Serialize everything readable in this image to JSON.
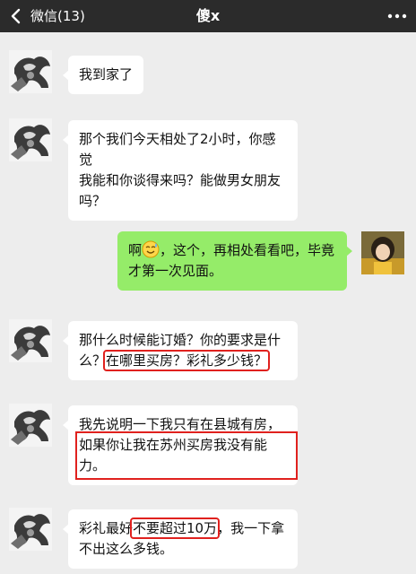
{
  "header": {
    "back_label": "微信(13)",
    "title": "傻x",
    "more_icon": "more-dots-icon"
  },
  "colors": {
    "header_bg": "#2b2b2b",
    "chat_bg": "#ededed",
    "incoming_bubble": "#ffffff",
    "outgoing_bubble": "#95ec69",
    "highlight_box": "#e0211e"
  },
  "messages": [
    {
      "side": "left",
      "text": "我到家了"
    },
    {
      "side": "left",
      "line1": "那个我们今天相处了2小时，你感觉",
      "line2": "我能和你谈得来吗？能做男女朋友",
      "line3": "吗？"
    },
    {
      "side": "right",
      "pre_emoji": "啊",
      "emoji": "sweat-smile-emoji",
      "post_emoji": "，这个，再相处看看吧，毕竟",
      "line2": "才第一次见面。"
    },
    {
      "side": "left",
      "line1": "那什么时候能订婚？你的要求是什",
      "line2_pre": "么？",
      "line2_highlight": "在哪里买房？彩礼多少钱？"
    },
    {
      "side": "left",
      "line1": "我先说明一下我只有在县城有房，",
      "highlight_line1": "如果你让我在苏州买房我没有能",
      "highlight_line2": "力。"
    },
    {
      "side": "left",
      "line1_pre": "彩礼最好",
      "line1_highlight": "不要超过10万",
      "line1_post": "，我一下拿",
      "line2": "不出这么多钱。"
    }
  ]
}
